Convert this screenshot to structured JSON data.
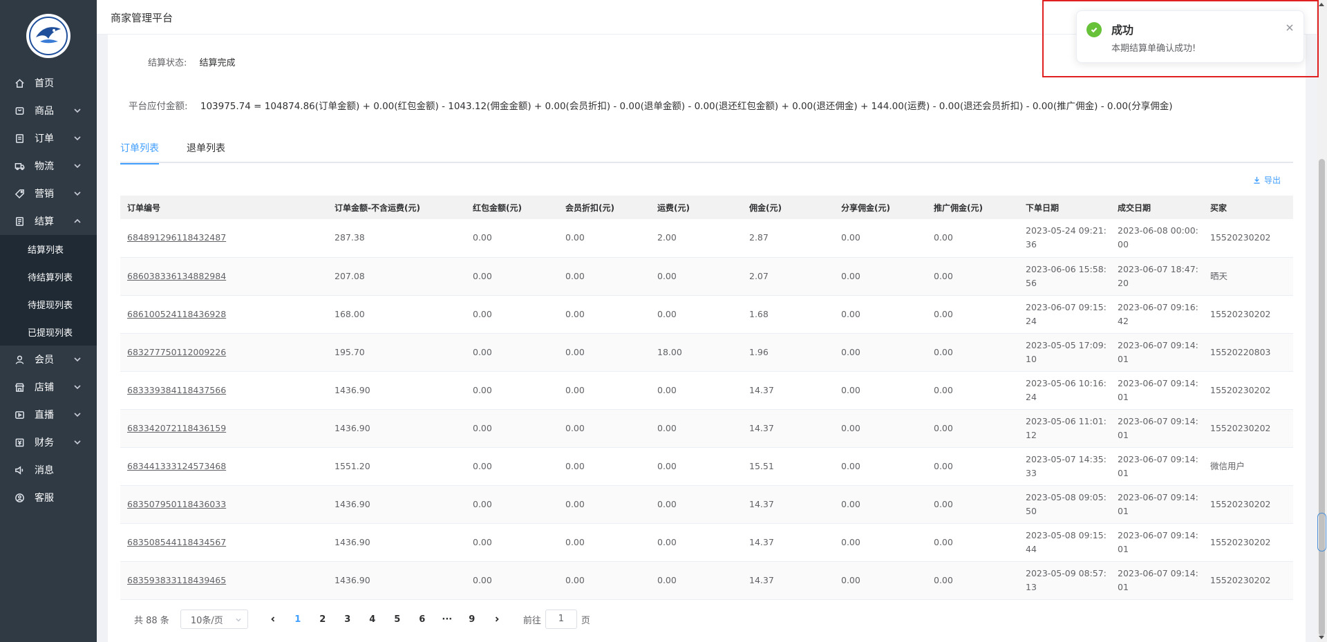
{
  "header": {
    "title": "商家管理平台"
  },
  "sidebar": {
    "items": [
      {
        "label": "首页",
        "icon": "home-icon"
      },
      {
        "label": "商品",
        "icon": "goods-icon"
      },
      {
        "label": "订单",
        "icon": "order-icon"
      },
      {
        "label": "物流",
        "icon": "truck-icon"
      },
      {
        "label": "营销",
        "icon": "tag-icon"
      },
      {
        "label": "结算",
        "icon": "settlement-icon"
      },
      {
        "label": "会员",
        "icon": "user-icon"
      },
      {
        "label": "店铺",
        "icon": "shop-icon"
      },
      {
        "label": "直播",
        "icon": "live-icon"
      },
      {
        "label": "财务",
        "icon": "finance-icon"
      },
      {
        "label": "消息",
        "icon": "speaker-icon"
      },
      {
        "label": "客服",
        "icon": "service-icon"
      }
    ],
    "settlement_sub": [
      "结算列表",
      "待结算列表",
      "待提现列表",
      "已提现列表"
    ]
  },
  "info": {
    "status_label": "结算状态:",
    "status_value": "结算完成",
    "amount_label": "平台应付金额:",
    "amount_formula": "103975.74 = 104874.86(订单金额) + 0.00(红包金额) - 1043.12(佣金金额) + 0.00(会员折扣) - 0.00(退单金额) - 0.00(退还红包金额) + 0.00(退还佣金) + 144.00(运费) - 0.00(退还会员折扣) - 0.00(推广佣金) - 0.00(分享佣金)"
  },
  "tabs": [
    "订单列表",
    "退单列表"
  ],
  "export_label": "导出",
  "table": {
    "headers": [
      "订单编号",
      "订单金额-不含运费(元)",
      "红包金额(元)",
      "会员折扣(元)",
      "运费(元)",
      "佣金(元)",
      "分享佣金(元)",
      "推广佣金(元)",
      "下单日期",
      "成交日期",
      "买家"
    ],
    "rows": [
      [
        "684891296118432487",
        "287.38",
        "0.00",
        "0.00",
        "2.00",
        "2.87",
        "0.00",
        "0.00",
        "2023-05-24 09:21:36",
        "2023-06-08 00:00:00",
        "15520230202"
      ],
      [
        "686038336134882984",
        "207.08",
        "0.00",
        "0.00",
        "0.00",
        "2.07",
        "0.00",
        "0.00",
        "2023-06-06 15:58:56",
        "2023-06-07 18:47:20",
        "晒天"
      ],
      [
        "686100524118436928",
        "168.00",
        "0.00",
        "0.00",
        "0.00",
        "1.68",
        "0.00",
        "0.00",
        "2023-06-07 09:15:24",
        "2023-06-07 09:16:42",
        "15520230202"
      ],
      [
        "683277750112009226",
        "195.70",
        "0.00",
        "0.00",
        "18.00",
        "1.96",
        "0.00",
        "0.00",
        "2023-05-05 17:09:10",
        "2023-06-07 09:14:01",
        "15520220803"
      ],
      [
        "683339384118437566",
        "1436.90",
        "0.00",
        "0.00",
        "0.00",
        "14.37",
        "0.00",
        "0.00",
        "2023-05-06 10:16:24",
        "2023-06-07 09:14:01",
        "15520230202"
      ],
      [
        "683342072118436159",
        "1436.90",
        "0.00",
        "0.00",
        "0.00",
        "14.37",
        "0.00",
        "0.00",
        "2023-05-06 11:01:12",
        "2023-06-07 09:14:01",
        "15520230202"
      ],
      [
        "683441333124573468",
        "1551.20",
        "0.00",
        "0.00",
        "0.00",
        "15.51",
        "0.00",
        "0.00",
        "2023-05-07 14:35:33",
        "2023-06-07 09:14:01",
        "微信用户"
      ],
      [
        "683507950118436033",
        "1436.90",
        "0.00",
        "0.00",
        "0.00",
        "14.37",
        "0.00",
        "0.00",
        "2023-05-08 09:05:50",
        "2023-06-07 09:14:01",
        "15520230202"
      ],
      [
        "683508544118434567",
        "1436.90",
        "0.00",
        "0.00",
        "0.00",
        "14.37",
        "0.00",
        "0.00",
        "2023-05-08 09:15:44",
        "2023-06-07 09:14:01",
        "15520230202"
      ],
      [
        "683593833118439465",
        "1436.90",
        "0.00",
        "0.00",
        "0.00",
        "14.37",
        "0.00",
        "0.00",
        "2023-05-09 08:57:13",
        "2023-06-07 09:14:01",
        "15520230202"
      ]
    ]
  },
  "pagination": {
    "total": "共 88 条",
    "page_size": "10条/页",
    "pages": [
      "1",
      "2",
      "3",
      "4",
      "5",
      "6",
      "···",
      "9"
    ],
    "current": "1",
    "goto_label": "前往",
    "goto_value": "1",
    "page_suffix": "页"
  },
  "toast": {
    "title": "成功",
    "message": "本期结算单确认成功!"
  },
  "colors": {
    "sidebar": "#2f3a45",
    "accent": "#409eff",
    "success": "#67c23a",
    "highlight": "#e02020"
  }
}
